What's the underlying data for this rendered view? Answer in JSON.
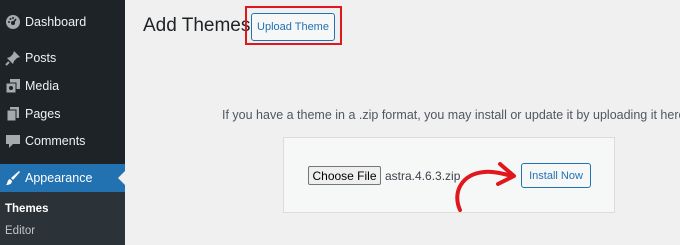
{
  "sidebar": {
    "items": [
      {
        "label": "Dashboard",
        "icon": "dashboard-icon"
      },
      {
        "label": "Posts",
        "icon": "pin-icon"
      },
      {
        "label": "Media",
        "icon": "media-icon"
      },
      {
        "label": "Pages",
        "icon": "pages-icon"
      },
      {
        "label": "Comments",
        "icon": "comment-icon"
      },
      {
        "label": "Appearance",
        "icon": "brush-icon"
      }
    ],
    "submenu": [
      {
        "label": "Themes"
      },
      {
        "label": "Editor"
      }
    ]
  },
  "main": {
    "title": "Add Themes",
    "upload_button": "Upload Theme",
    "intro": "If you have a theme in a .zip format, you may install or update it by uploading it here.",
    "choose_file": "Choose File",
    "file_name": "astra.4.6.3.zip",
    "install_button": "Install Now"
  },
  "colors": {
    "sidebar_bg": "#1d2327",
    "active_bg": "#2271b1",
    "annotation": "#e0171c"
  }
}
